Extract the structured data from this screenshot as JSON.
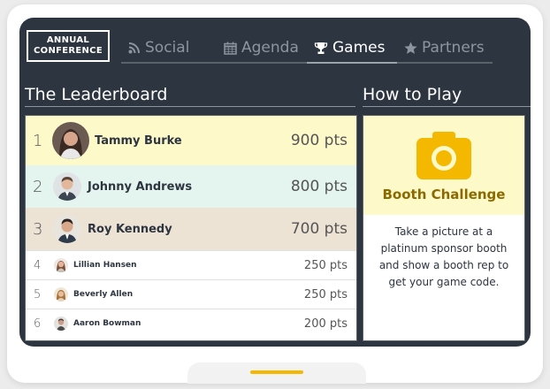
{
  "logo": {
    "line1": "ANNUAL",
    "line2": "CONFERENCE"
  },
  "nav": {
    "tabs": [
      {
        "label": "Social",
        "icon": "rss-icon"
      },
      {
        "label": "Agenda",
        "icon": "calendar-icon"
      },
      {
        "label": "Games",
        "icon": "trophy-icon",
        "active": true
      },
      {
        "label": "Partners",
        "icon": "star-icon"
      }
    ]
  },
  "leaderboard": {
    "title": "The Leaderboard",
    "rows": [
      {
        "rank": "1",
        "name": "Tammy Burke",
        "points": "900 pts"
      },
      {
        "rank": "2",
        "name": "Johnny Andrews",
        "points": "800 pts"
      },
      {
        "rank": "3",
        "name": "Roy Kennedy",
        "points": "700 pts"
      },
      {
        "rank": "4",
        "name": "Lillian Hansen",
        "points": "250 pts"
      },
      {
        "rank": "5",
        "name": "Beverly Allen",
        "points": "250 pts"
      },
      {
        "rank": "6",
        "name": "Aaron Bowman",
        "points": "200 pts"
      }
    ]
  },
  "how_to_play": {
    "title": "How to Play",
    "challenge_title": "Booth Challenge",
    "challenge_icon": "camera-icon",
    "description": "Take a picture at a platinum sponsor booth and show a booth rep to get your game code."
  },
  "colors": {
    "screen_bg": "#2d3540",
    "rank1_bg": "#fef9c8",
    "rank2_bg": "#e4f4ef",
    "rank3_bg": "#ede3d5",
    "accent": "#f5b800",
    "challenge_title": "#8a6a00"
  }
}
